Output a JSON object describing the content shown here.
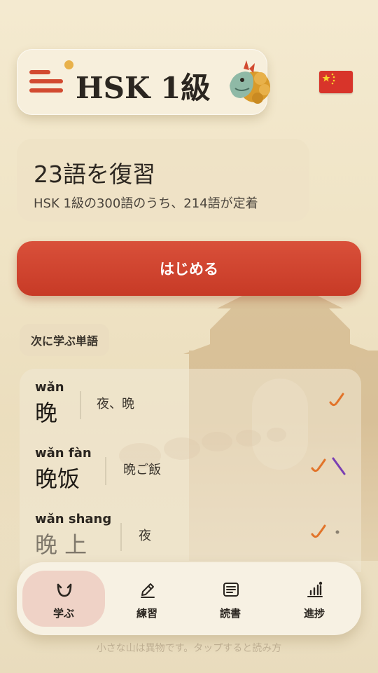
{
  "header": {
    "title": "HSK 1級",
    "menu_icon": "menu-icon",
    "mascot_icon": "dragon-icon",
    "flag_icon": "china-flag-icon"
  },
  "review": {
    "title": "23語を復習",
    "subtitle": "HSK 1級の300語のうち、214語が定着"
  },
  "start_button": {
    "label": "はじめる"
  },
  "next_words": {
    "heading": "次に学ぶ単語",
    "items": [
      {
        "pinyin": "wǎn",
        "hanzi": "晚",
        "meaning": "夜、晩"
      },
      {
        "pinyin": "wǎn fàn",
        "hanzi": "晚饭",
        "meaning": "晩ご飯"
      },
      {
        "pinyin": "wǎn shang",
        "hanzi": "晚 上",
        "meaning": "夜"
      }
    ]
  },
  "nav": {
    "items": [
      {
        "label": "学ぶ",
        "icon": "learn-icon",
        "active": true
      },
      {
        "label": "練習",
        "icon": "pencil-icon",
        "active": false
      },
      {
        "label": "読書",
        "icon": "reading-icon",
        "active": false
      },
      {
        "label": "進捗",
        "icon": "progress-chart-icon",
        "active": false
      }
    ]
  },
  "footer": {
    "text": "小さな山は異物です。タップすると読み方"
  },
  "colors": {
    "accent": "#c73a26",
    "gold": "#e8b14a",
    "background": "#f4ead0"
  }
}
